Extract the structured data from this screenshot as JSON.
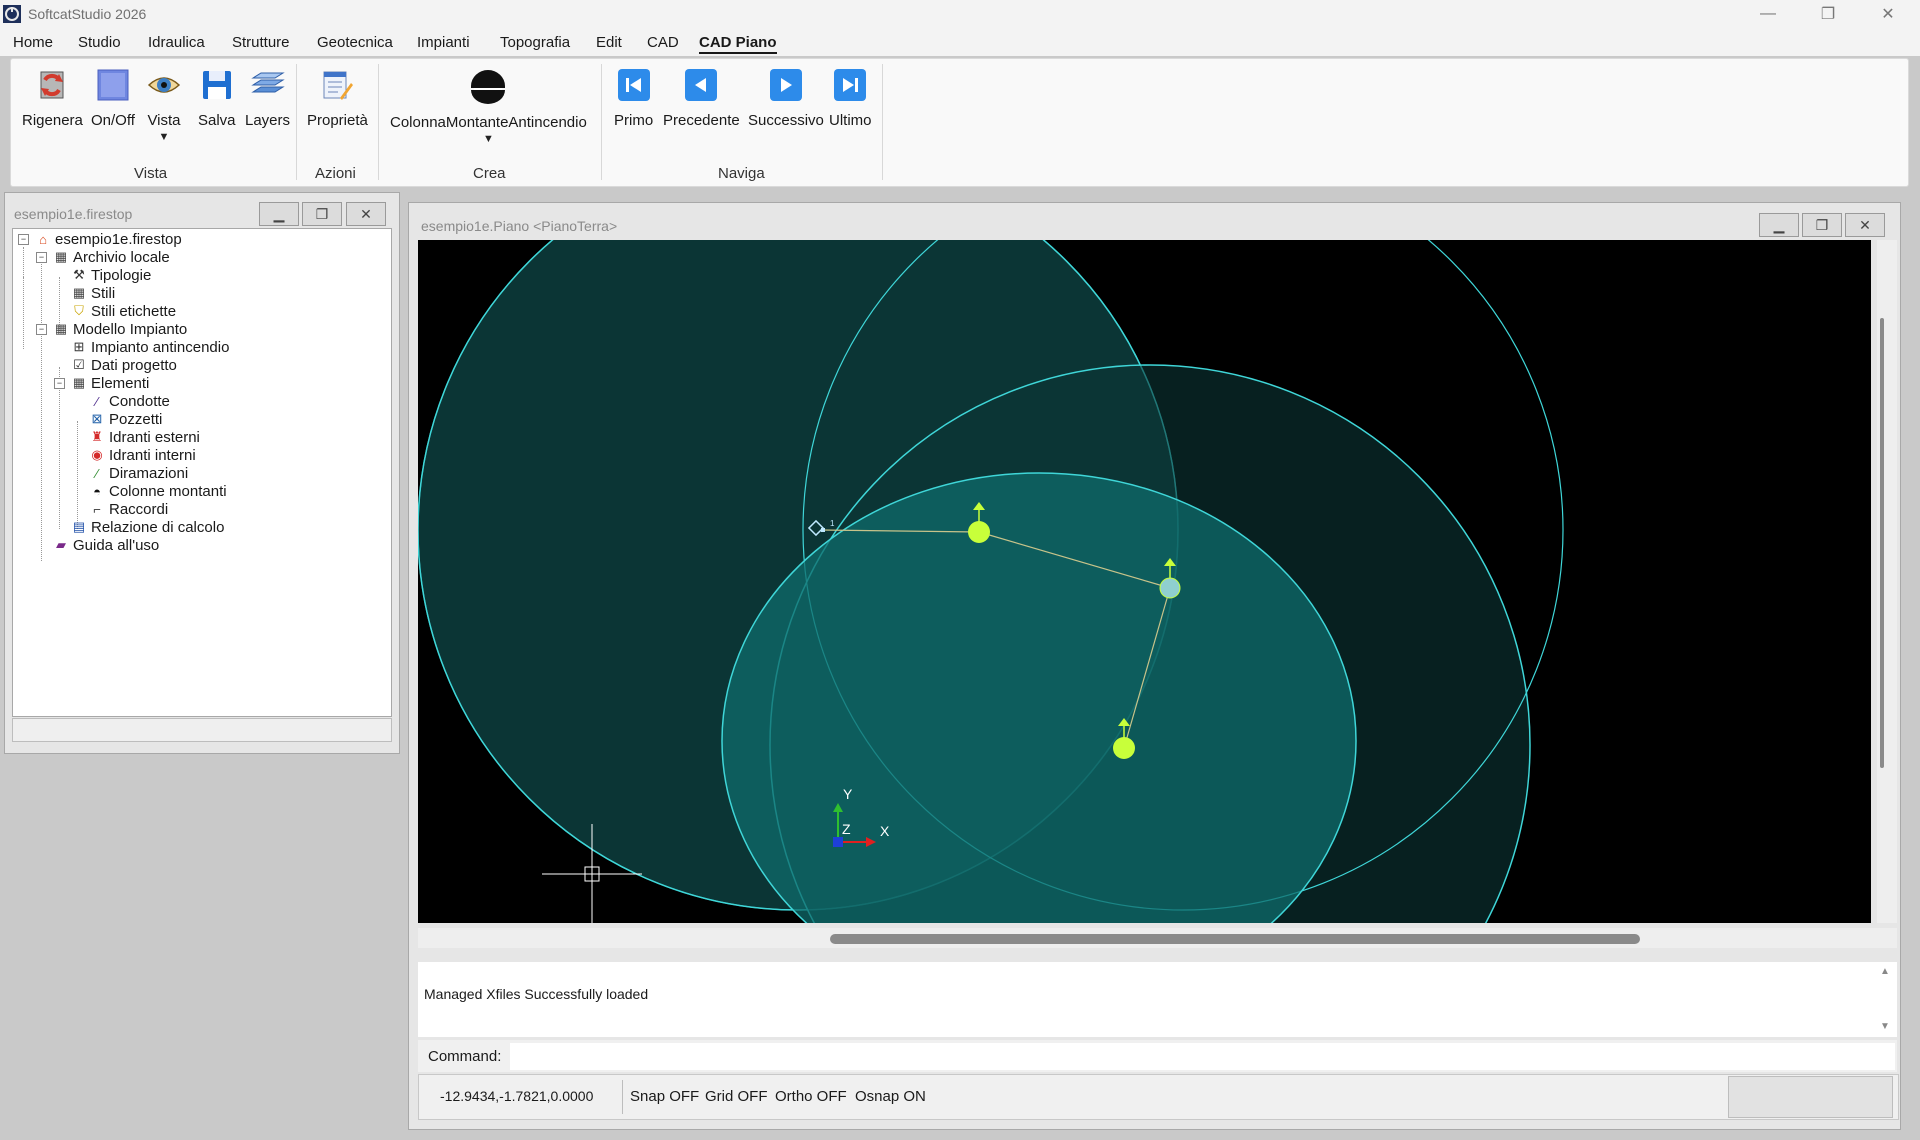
{
  "app": {
    "title": "SoftcatStudio 2026",
    "window_controls": [
      "minimize",
      "restore",
      "close"
    ]
  },
  "menu": {
    "items": [
      "Home",
      "Studio",
      "Idraulica",
      "Strutture",
      "Geotecnica",
      "Impianti",
      "Topografia",
      "Edit",
      "CAD",
      "CAD Piano"
    ],
    "active": "CAD Piano"
  },
  "ribbon": {
    "buttons": {
      "rigenera": "Rigenera",
      "onoff": "On/Off",
      "vista": "Vista",
      "salva": "Salva",
      "layers": "Layers",
      "proprieta": "Proprietà",
      "colonna": "ColonnaMontanteAntincendio",
      "primo": "Primo",
      "precedente": "Precedente",
      "successivo": "Successivo",
      "ultimo": "Ultimo"
    },
    "groups": {
      "vista": "Vista",
      "azioni": "Azioni",
      "crea": "Crea",
      "naviga": "Naviga"
    }
  },
  "tree": {
    "window_title": "esempio1e.firestop",
    "nodes": [
      "esempio1e.firestop",
      "Archivio locale",
      "Tipologie",
      "Stili",
      "Stili etichette",
      "Modello Impianto",
      "Impianto antincendio",
      "Dati progetto",
      "Elementi",
      "Condotte",
      "Pozzetti",
      "Idranti esterni",
      "Idranti interni",
      "Diramazioni",
      "Colonne montanti",
      "Raccordi",
      "Relazione di calcolo",
      "Guida all'uso"
    ]
  },
  "cad": {
    "window_title": "esempio1e.Piano <PianoTerra>",
    "node_label": "1",
    "axis_labels": {
      "x": "X",
      "y": "Y",
      "z": "Z"
    },
    "colors": {
      "background": "#000000",
      "circle_outline": "#3fd6d8",
      "circle_fill": "#0f6b6b",
      "node": "#c8ff3a",
      "pipe": "#c7c38a"
    }
  },
  "console": {
    "message": "Managed Xfiles Successfully loaded",
    "command_label": "Command:",
    "command_value": ""
  },
  "status": {
    "coordinates": "-12.9434,-1.7821,0.0000",
    "snap": "Snap OFF",
    "grid": "Grid OFF",
    "ortho": "Ortho OFF",
    "osnap": "Osnap ON"
  }
}
